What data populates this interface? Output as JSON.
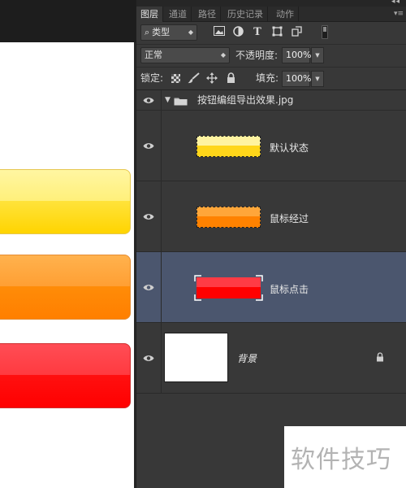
{
  "tabs": [
    {
      "label": "图层",
      "active": true
    },
    {
      "label": "通道",
      "active": false
    },
    {
      "label": "路径",
      "active": false
    },
    {
      "label": "历史记录",
      "active": false
    },
    {
      "label": "动作",
      "active": false
    }
  ],
  "panel_menu_icon": "panel-menu-icon",
  "filter": {
    "kind_label": "类型",
    "icons": [
      "image-filter-icon",
      "adjustment-filter-icon",
      "type-filter-icon",
      "shape-filter-icon",
      "smart-object-filter-icon"
    ],
    "type_glyph": "T"
  },
  "blend": {
    "mode": "正常",
    "opacity_label": "不透明度:",
    "opacity_value": "100%"
  },
  "lock": {
    "label": "锁定:",
    "fill_label": "填充:",
    "fill_value": "100%",
    "icons": [
      "lock-transparent-icon",
      "lock-image-icon",
      "lock-position-icon",
      "lock-all-icon"
    ]
  },
  "layers": {
    "group": {
      "name": "按钮编组导出效果.jpg",
      "expanded": true
    },
    "items": [
      {
        "name": "默认状态",
        "color": "#ffd91a",
        "selected": false
      },
      {
        "name": "鼠标经过",
        "color": "#ff8a00",
        "selected": false
      },
      {
        "name": "鼠标点击",
        "color": "#ff0000",
        "selected": true
      }
    ],
    "background": {
      "name": "背景",
      "locked": true
    }
  },
  "canvas": {
    "buttons": [
      {
        "state": "default",
        "color": "#ffd619"
      },
      {
        "state": "hover",
        "color": "#ff8a00"
      },
      {
        "state": "pressed",
        "color": "#ff0000"
      }
    ]
  },
  "selection_color": "#4b566e",
  "watermark": "软件技巧"
}
